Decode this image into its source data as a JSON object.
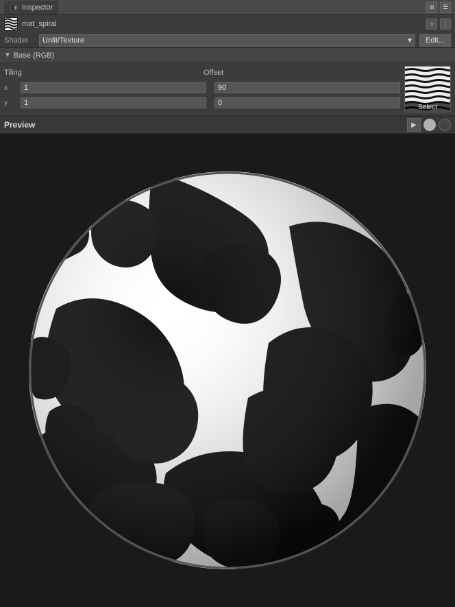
{
  "titlebar": {
    "tab_label": "Inspector",
    "icon": "inspector-icon"
  },
  "material": {
    "name": "mat_spiral",
    "shader_label": "Shader",
    "shader_value": "Unlit/Texture",
    "edit_btn": "Edit...",
    "icon_favorite": "★",
    "icon_dots": "⋮"
  },
  "section": {
    "title": "Base (RGB)",
    "tiling_label": "Tiling",
    "offset_label": "Offset",
    "x_label": "x",
    "y_label": "y",
    "tiling_x": "1",
    "tiling_y": "1",
    "offset_x": "90",
    "offset_y": "0",
    "select_btn": "Select"
  },
  "preview": {
    "title": "Preview",
    "play_icon": "▶",
    "ball_icon": "●",
    "dark_icon": "●"
  },
  "colors": {
    "bg_dark": "#3c3c3c",
    "bg_darker": "#2a2a2a",
    "bg_section": "#444444",
    "accent": "#555555",
    "text_primary": "#e0e0e0",
    "text_secondary": "#aaaaaa"
  }
}
